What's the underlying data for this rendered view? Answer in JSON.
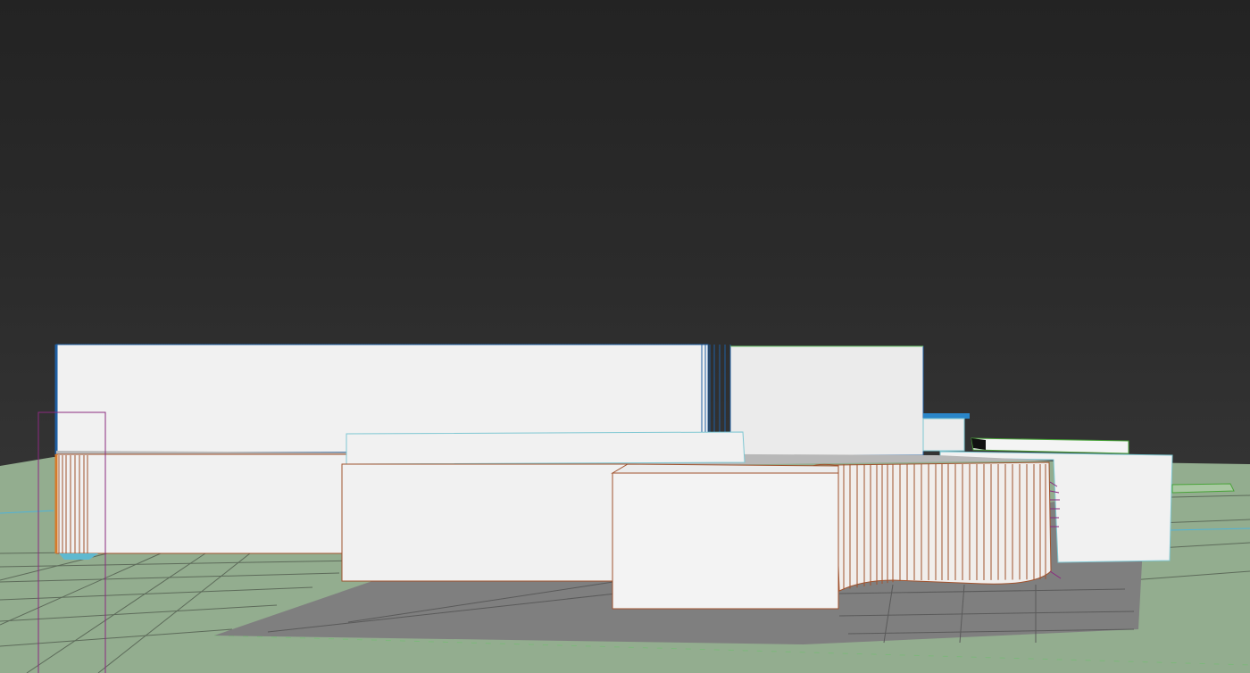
{
  "viewport": {
    "view": "perspective",
    "background_color": "#2b2b2b",
    "ground_color": "#93ad8f",
    "grid_color": "#5d6b5a",
    "shadow_color": "#7f7f7f",
    "horizon_line_color": "#4fb3d9"
  },
  "objects": [
    {
      "name": "back-wall",
      "edge_color": "#1f5fa3",
      "face_color": "#f1f1f1"
    },
    {
      "name": "back-wall-right",
      "edge_color": "#1f5fa3",
      "face_color": "#ebebeb"
    },
    {
      "name": "blue-cap",
      "edge_color": "#1e78c8",
      "face_color": "#2a86c9"
    },
    {
      "name": "mid-slab",
      "edge_color": "#7ec7d2",
      "face_color": "#f1f1f1"
    },
    {
      "name": "left-box",
      "edge_color": "#a0522d",
      "face_color": "#f1f1f1"
    },
    {
      "name": "center-box",
      "edge_color": "#a0522d",
      "face_color": "#f1f1f1"
    },
    {
      "name": "front-box",
      "edge_color": "#a0522d",
      "face_color": "#f3f3f3"
    },
    {
      "name": "curved-wall",
      "edge_color": "#a0522d",
      "face_color": "#f1eeec"
    },
    {
      "name": "right-box",
      "edge_color": "#7ec7d2",
      "face_color": "#f1f1f1"
    },
    {
      "name": "green-slab",
      "edge_color": "#4aa33a",
      "face_color": "#f4f4f4"
    },
    {
      "name": "selection-frame",
      "edge_color": "#8b2a80"
    }
  ]
}
